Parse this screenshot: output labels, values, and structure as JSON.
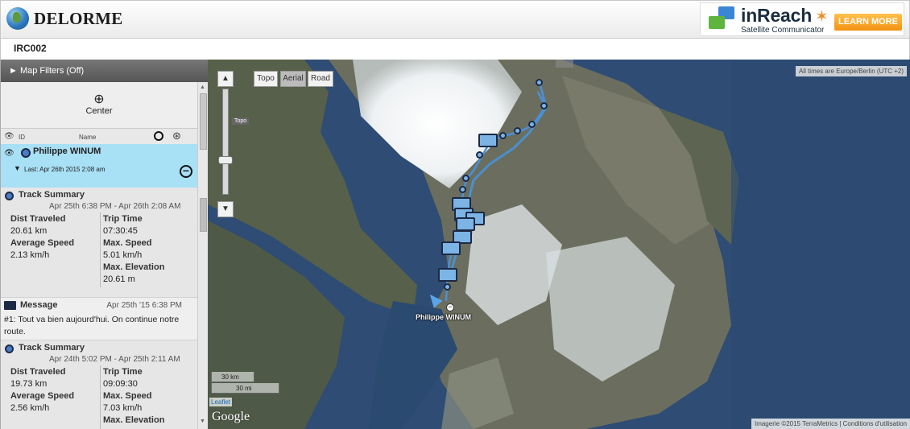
{
  "header": {
    "logo_text": "DELORME",
    "ad": {
      "brand": "inReach",
      "subtitle": "Satellite Communicator",
      "button": "LEARN MORE"
    }
  },
  "titlebar": {
    "device_id": "IRC002"
  },
  "sidebar": {
    "filters_label": "► Map Filters (Off)",
    "center_label": "Center",
    "columns": {
      "id": "ID",
      "name": "Name"
    },
    "device": {
      "name": "Philippe WINUM",
      "last": "Last: Apr 26th 2015 2:08 am"
    },
    "feed": [
      {
        "type": "track",
        "title": "Track Summary",
        "range": "Apr 25th 6:38 PM - Apr 26th 2:08 AM",
        "dist_label": "Dist Traveled",
        "dist": "20.61 km",
        "trip_label": "Trip Time",
        "trip": "07:30:45",
        "avg_label": "Average Speed",
        "avg": "2.13 km/h",
        "max_label": "Max. Speed",
        "max": "5.01 km/h",
        "elev_label": "Max. Elevation",
        "elev": "20.61 m"
      },
      {
        "type": "message",
        "title": "Message",
        "date": "Apr 25th '15 6:38 PM",
        "body": "#1: Tout va bien aujourd'hui. On continue notre route."
      },
      {
        "type": "track",
        "title": "Track Summary",
        "range": "Apr 24th 5:02 PM - Apr 25th 2:11 AM",
        "dist_label": "Dist Traveled",
        "dist": "19.73 km",
        "trip_label": "Trip Time",
        "trip": "09:09:30",
        "avg_label": "Average Speed",
        "avg": "2.56 km/h",
        "max_label": "Max. Speed",
        "max": "7.03 km/h",
        "elev_label": "Max. Elevation",
        "elev": ""
      }
    ]
  },
  "map": {
    "layers": [
      "Topo",
      "Aerial",
      "Road"
    ],
    "active_layer": "Aerial",
    "zoom_tooltip": "Topo",
    "timezone": "All times are Europe/Berlin (UTC +2)",
    "marker_label": "Philippe WINUM",
    "scale": [
      "30 km",
      "30 mi"
    ],
    "leaflet": "Leaflet",
    "google": "Google",
    "attribution_1": "Imagerie ©2015 TerraMetrics",
    "attribution_2": "Conditions d'utilisation"
  },
  "colors": {
    "accent": "#a8e0f5",
    "track": "#4a8fcf"
  }
}
